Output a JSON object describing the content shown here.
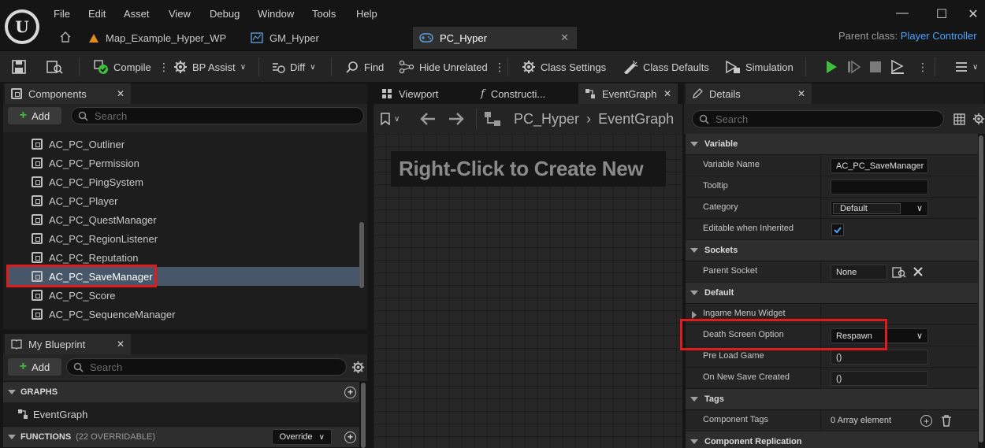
{
  "menu": [
    "File",
    "Edit",
    "Asset",
    "View",
    "Debug",
    "Window",
    "Tools",
    "Help"
  ],
  "tabs": [
    {
      "label": "Map_Example_Hyper_WP"
    },
    {
      "label": "GM_Hyper"
    },
    {
      "label": "PC_Hyper"
    }
  ],
  "parent_class": {
    "label": "Parent class:",
    "value": "Player Controller"
  },
  "toolbar": {
    "compile": "Compile",
    "bp_assist": "BP Assist",
    "diff": "Diff",
    "find": "Find",
    "hide_unrelated": "Hide Unrelated",
    "class_settings": "Class Settings",
    "class_defaults": "Class Defaults",
    "simulation": "Simulation"
  },
  "components": {
    "title": "Components",
    "add": "Add",
    "search_placeholder": "Search",
    "items": [
      "AC_PC_Outliner",
      "AC_PC_Permission",
      "AC_PC_PingSystem",
      "AC_PC_Player",
      "AC_PC_QuestManager",
      "AC_PC_RegionListener",
      "AC_PC_Reputation",
      "AC_PC_SaveManager",
      "AC_PC_Score",
      "AC_PC_SequenceManager"
    ]
  },
  "my_blueprint": {
    "title": "My Blueprint",
    "add": "Add",
    "search_placeholder": "Search",
    "graphs_label": "GRAPHS",
    "event_graph": "EventGraph",
    "functions_label": "FUNCTIONS",
    "functions_count": "(22 OVERRIDABLE)",
    "override": "Override"
  },
  "graph": {
    "tabs": [
      "Viewport",
      "Constructi...",
      "EventGraph"
    ],
    "breadcrumb_root": "PC_Hyper",
    "breadcrumb_leaf": "EventGraph",
    "hint": "Right-Click to Create New"
  },
  "details": {
    "title": "Details",
    "search_placeholder": "Search",
    "sections": {
      "variable": "Variable",
      "sockets": "Sockets",
      "default": "Default",
      "tags": "Tags",
      "replication": "Component Replication"
    },
    "rows": {
      "variable_name": {
        "label": "Variable Name",
        "value": "AC_PC_SaveManager"
      },
      "tooltip": {
        "label": "Tooltip",
        "value": ""
      },
      "category": {
        "label": "Category",
        "value": "Default"
      },
      "editable": {
        "label": "Editable when Inherited",
        "checked": true
      },
      "parent_socket": {
        "label": "Parent Socket",
        "value": "None"
      },
      "ingame_menu": {
        "label": "Ingame Menu Widget"
      },
      "death_screen": {
        "label": "Death Screen Option",
        "value": "Respawn"
      },
      "pre_load": {
        "label": "Pre Load Game",
        "value": "()"
      },
      "on_new_save": {
        "label": "On New Save Created",
        "value": "()"
      },
      "component_tags": {
        "label": "Component Tags",
        "value": "0 Array element"
      }
    }
  },
  "colors": {
    "highlight": "#e01b1b",
    "selection": "#48566a",
    "link": "#4aa3ff",
    "play_green": "#3cbf3c"
  }
}
